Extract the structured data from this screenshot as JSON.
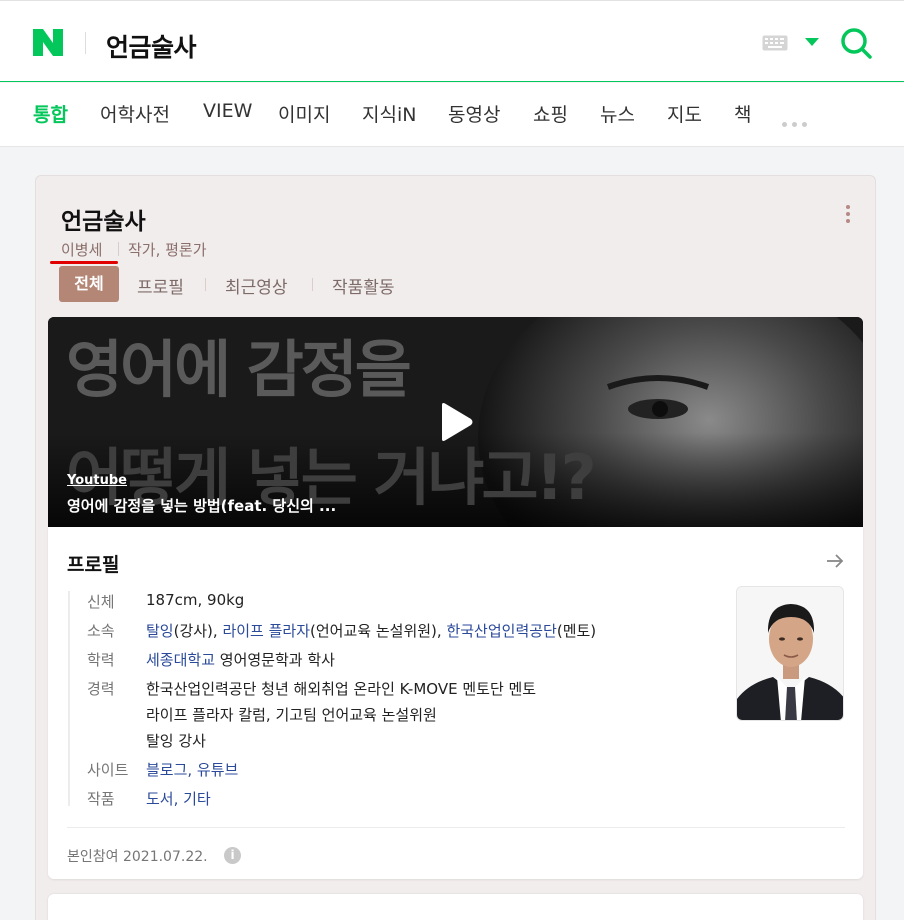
{
  "header": {
    "logo": "N",
    "query": "언금술사",
    "icons": [
      "keyboard-icon",
      "dropdown-caret-icon",
      "search-icon"
    ],
    "accent_color": "#03c75a"
  },
  "tabs": [
    "통합",
    "어학사전",
    "VIEW",
    "이미지",
    "지식iN",
    "동영상",
    "쇼핑",
    "뉴스",
    "지도",
    "책"
  ],
  "card": {
    "title": "언금술사",
    "name": "이병세",
    "description": "작가, 평론가",
    "subtabs": [
      "전체",
      "프로필",
      "최근영상",
      "작품활동"
    ],
    "accent_color": "#b38676"
  },
  "video": {
    "overlay_line1": "영어에 감정을",
    "overlay_line2": "어떻게 넣는 거냐고!?",
    "source": "Youtube",
    "title": "영어에 감정을 넣는 방법(feat. 당신의 ..."
  },
  "profile": {
    "heading": "프로필",
    "rows": {
      "body": {
        "label": "신체",
        "value": "187cm, 90kg"
      },
      "affiliation": {
        "label": "소속",
        "l1": "탈잉",
        "t1": "(강사), ",
        "l2": "라이프 플라자",
        "t2": "(언어교육 논설위원), ",
        "l3": "한국산업인력공단",
        "t3": "(멘토)"
      },
      "education": {
        "label": "학력",
        "link": "세종대학교",
        "rest": " 영어영문학과 학사"
      },
      "career": {
        "label": "경력",
        "lines": [
          "한국산업인력공단 청년 해외취업 온라인 K-MOVE 멘토단 멘토",
          "라이프 플라자 칼럼, 기고팀 언어교육 논설위원",
          "탈잉 강사"
        ]
      },
      "site": {
        "label": "사이트",
        "link": "블로그, 유튜브"
      },
      "works": {
        "label": "작품",
        "link": "도서, 기타"
      }
    },
    "footer": "본인참여 2021.07.22.",
    "info_glyph": "i"
  }
}
